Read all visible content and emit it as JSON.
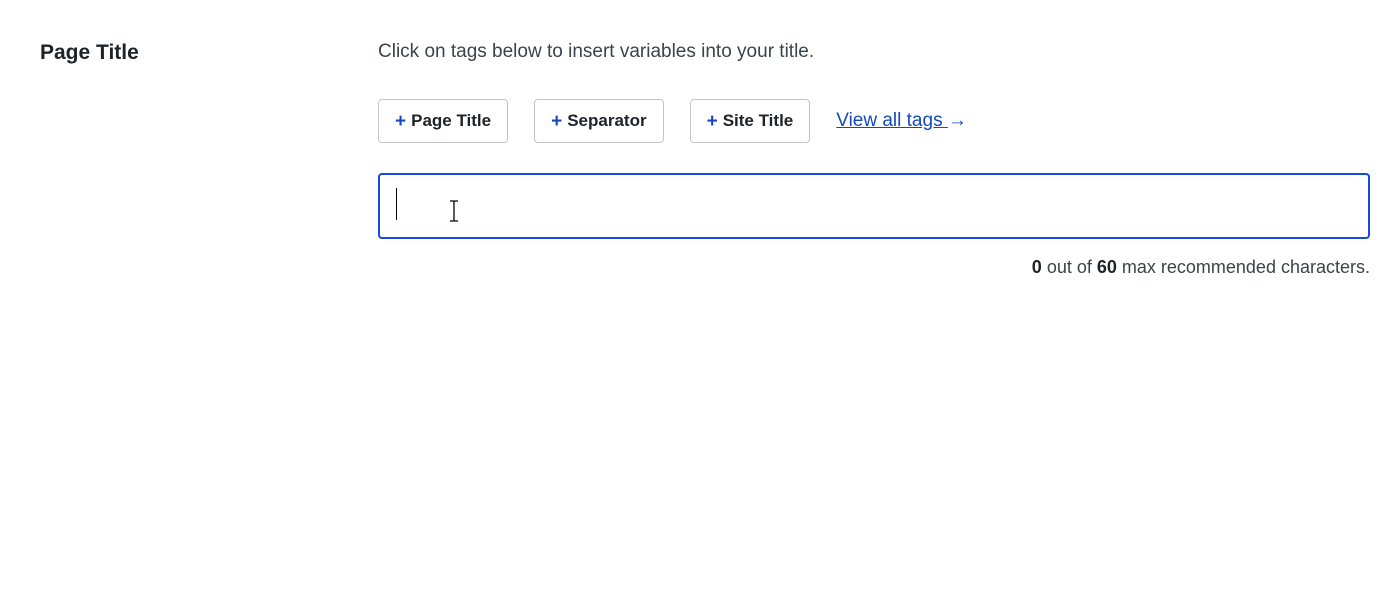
{
  "label": "Page Title",
  "help_text": "Click on tags below to insert variables into your title.",
  "tags": [
    {
      "label": "Page Title"
    },
    {
      "label": "Separator"
    },
    {
      "label": "Site Title"
    }
  ],
  "view_all": {
    "text": "View all tags ",
    "arrow": "→"
  },
  "input": {
    "value": ""
  },
  "counter": {
    "current": "0",
    "mid1": " out of ",
    "max": "60",
    "mid2": " max recommended characters."
  }
}
